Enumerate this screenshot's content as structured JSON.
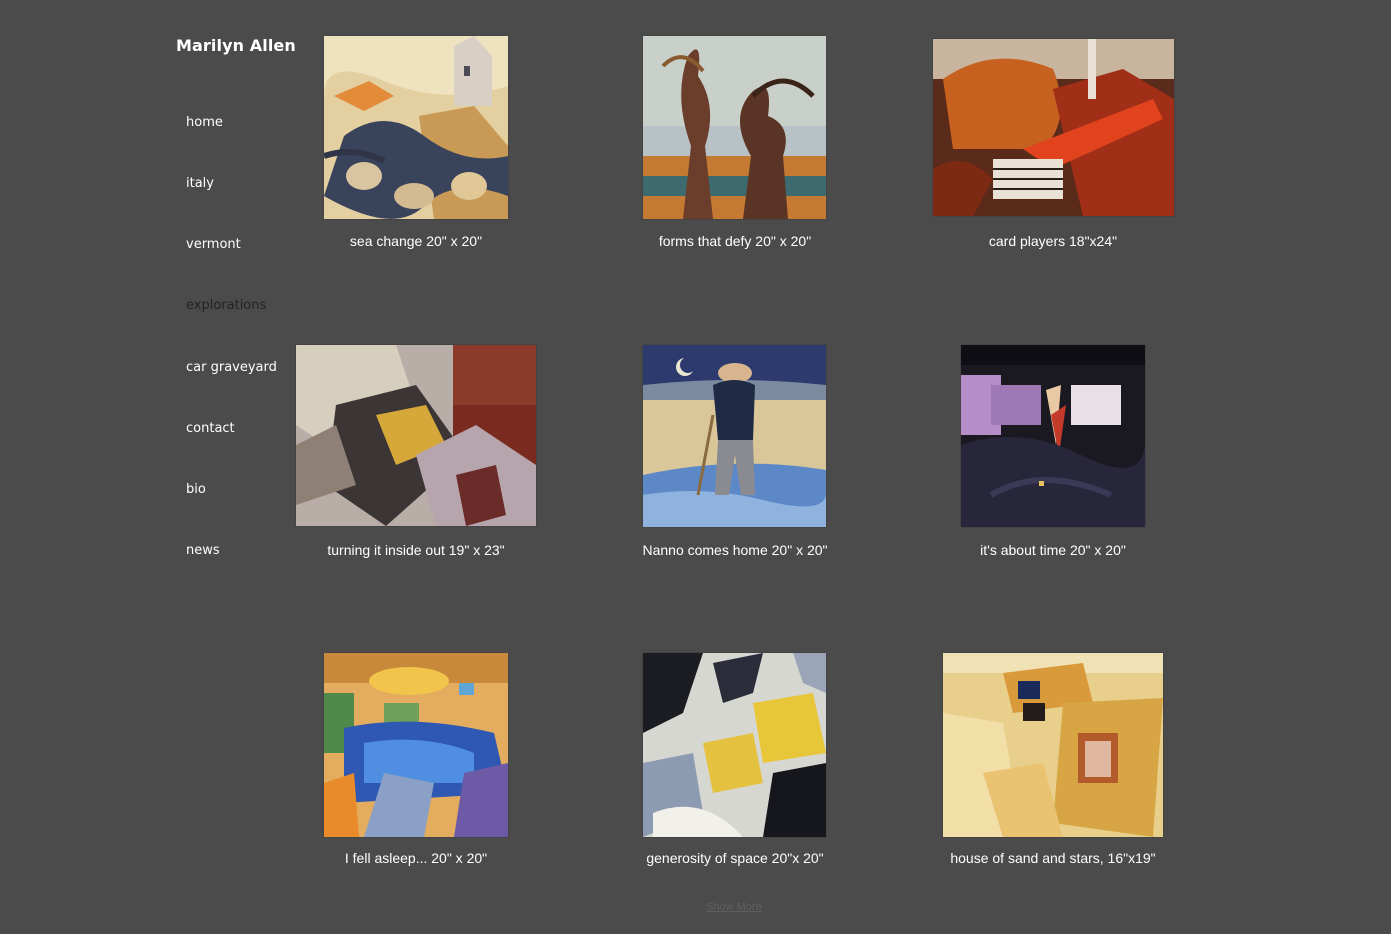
{
  "site": {
    "title": "Marilyn Allen"
  },
  "nav": {
    "items": [
      {
        "label": "home"
      },
      {
        "label": "italy"
      },
      {
        "label": "vermont"
      },
      {
        "label": "explorations",
        "current": true
      },
      {
        "label": "car graveyard"
      },
      {
        "label": "contact"
      },
      {
        "label": "bio"
      },
      {
        "label": "news"
      }
    ]
  },
  "gallery": {
    "items": [
      {
        "caption": "sea change 20\" x 20\""
      },
      {
        "caption": "forms that defy 20\" x 20\""
      },
      {
        "caption": "card players 18\"x24\""
      },
      {
        "caption": "turning it inside out 19\" x 23\""
      },
      {
        "caption": "Nanno comes home 20\" x 20\""
      },
      {
        "caption": "it's about time 20\" x 20\""
      },
      {
        "caption": "I fell asleep... 20\" x 20\""
      },
      {
        "caption": "generosity of space 20\"x 20\""
      },
      {
        "caption": "house of sand and stars, 16\"x19\""
      }
    ],
    "show_more_label": "Show More"
  }
}
